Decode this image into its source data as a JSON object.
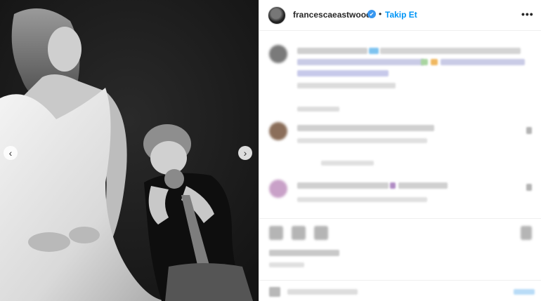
{
  "post": {
    "username": "francescaeastwood",
    "verified_mark": "✔",
    "separator": "•",
    "follow_label": "Takip Et",
    "more_label": "•••"
  },
  "carousel": {
    "prev_glyph": "‹",
    "next_glyph": "›"
  },
  "colors": {
    "accent": "#0095f6",
    "verified": "#3897f0",
    "photo_bg": "#1f1f1f",
    "blur_text": "#d2d2d2"
  },
  "icons": [
    "verified-badge-icon",
    "more-options-icon",
    "chevron-left-icon",
    "chevron-right-icon",
    "like-icon",
    "comment-icon",
    "share-icon",
    "save-icon"
  ]
}
